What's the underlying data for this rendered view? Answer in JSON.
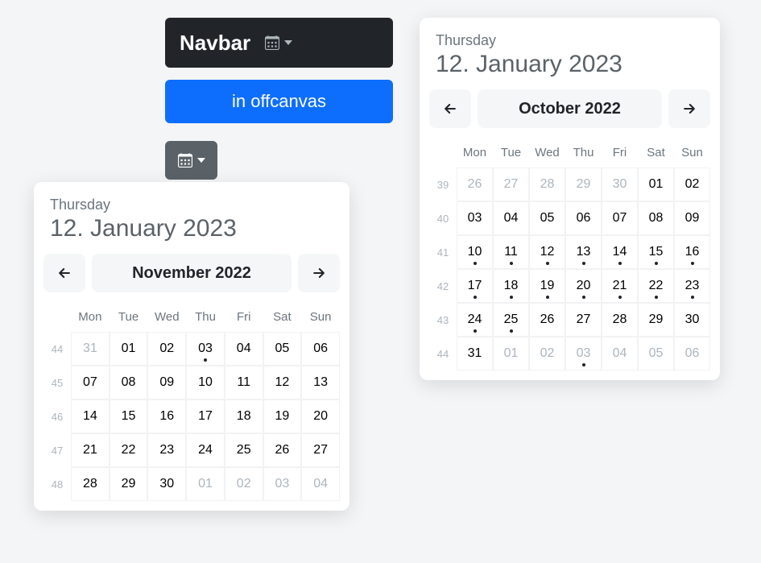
{
  "navbar": {
    "brand": "Navbar"
  },
  "buttons": {
    "offcanvas": "in offcanvas"
  },
  "datepicker1": {
    "weekday": "Thursday",
    "date": "12. January 2023",
    "month_label": "November 2022",
    "dows": [
      "Mon",
      "Tue",
      "Wed",
      "Thu",
      "Fri",
      "Sat",
      "Sun"
    ],
    "weeks": [
      {
        "wk": "44",
        "days": [
          {
            "d": "31",
            "muted": true
          },
          {
            "d": "01"
          },
          {
            "d": "02"
          },
          {
            "d": "03",
            "dot": true
          },
          {
            "d": "04"
          },
          {
            "d": "05"
          },
          {
            "d": "06"
          }
        ]
      },
      {
        "wk": "45",
        "days": [
          {
            "d": "07"
          },
          {
            "d": "08"
          },
          {
            "d": "09"
          },
          {
            "d": "10"
          },
          {
            "d": "11"
          },
          {
            "d": "12"
          },
          {
            "d": "13"
          }
        ]
      },
      {
        "wk": "46",
        "days": [
          {
            "d": "14"
          },
          {
            "d": "15"
          },
          {
            "d": "16"
          },
          {
            "d": "17"
          },
          {
            "d": "18"
          },
          {
            "d": "19"
          },
          {
            "d": "20"
          }
        ]
      },
      {
        "wk": "47",
        "days": [
          {
            "d": "21"
          },
          {
            "d": "22"
          },
          {
            "d": "23"
          },
          {
            "d": "24"
          },
          {
            "d": "25"
          },
          {
            "d": "26"
          },
          {
            "d": "27"
          }
        ]
      },
      {
        "wk": "48",
        "days": [
          {
            "d": "28"
          },
          {
            "d": "29"
          },
          {
            "d": "30"
          },
          {
            "d": "01",
            "muted": true
          },
          {
            "d": "02",
            "muted": true
          },
          {
            "d": "03",
            "muted": true
          },
          {
            "d": "04",
            "muted": true
          }
        ]
      }
    ]
  },
  "datepicker2": {
    "weekday": "Thursday",
    "date": "12. January 2023",
    "month_label": "October 2022",
    "dows": [
      "Mon",
      "Tue",
      "Wed",
      "Thu",
      "Fri",
      "Sat",
      "Sun"
    ],
    "weeks": [
      {
        "wk": "39",
        "days": [
          {
            "d": "26",
            "muted": true
          },
          {
            "d": "27",
            "muted": true
          },
          {
            "d": "28",
            "muted": true
          },
          {
            "d": "29",
            "muted": true
          },
          {
            "d": "30",
            "muted": true
          },
          {
            "d": "01"
          },
          {
            "d": "02"
          }
        ]
      },
      {
        "wk": "40",
        "days": [
          {
            "d": "03"
          },
          {
            "d": "04"
          },
          {
            "d": "05"
          },
          {
            "d": "06"
          },
          {
            "d": "07"
          },
          {
            "d": "08"
          },
          {
            "d": "09"
          }
        ]
      },
      {
        "wk": "41",
        "days": [
          {
            "d": "10",
            "dot": true
          },
          {
            "d": "11",
            "dot": true
          },
          {
            "d": "12",
            "dot": true
          },
          {
            "d": "13",
            "dot": true
          },
          {
            "d": "14",
            "dot": true
          },
          {
            "d": "15",
            "dot": true
          },
          {
            "d": "16",
            "dot": true
          }
        ]
      },
      {
        "wk": "42",
        "days": [
          {
            "d": "17",
            "dot": true
          },
          {
            "d": "18",
            "dot": true
          },
          {
            "d": "19",
            "dot": true
          },
          {
            "d": "20",
            "dot": true
          },
          {
            "d": "21",
            "dot": true
          },
          {
            "d": "22",
            "dot": true
          },
          {
            "d": "23",
            "dot": true
          }
        ]
      },
      {
        "wk": "43",
        "days": [
          {
            "d": "24",
            "dot": true
          },
          {
            "d": "25",
            "dot": true
          },
          {
            "d": "26"
          },
          {
            "d": "27"
          },
          {
            "d": "28"
          },
          {
            "d": "29"
          },
          {
            "d": "30"
          }
        ]
      },
      {
        "wk": "44",
        "days": [
          {
            "d": "31"
          },
          {
            "d": "01",
            "muted": true
          },
          {
            "d": "02",
            "muted": true
          },
          {
            "d": "03",
            "muted": true,
            "dot": true
          },
          {
            "d": "04",
            "muted": true
          },
          {
            "d": "05",
            "muted": true
          },
          {
            "d": "06",
            "muted": true
          }
        ]
      }
    ]
  }
}
